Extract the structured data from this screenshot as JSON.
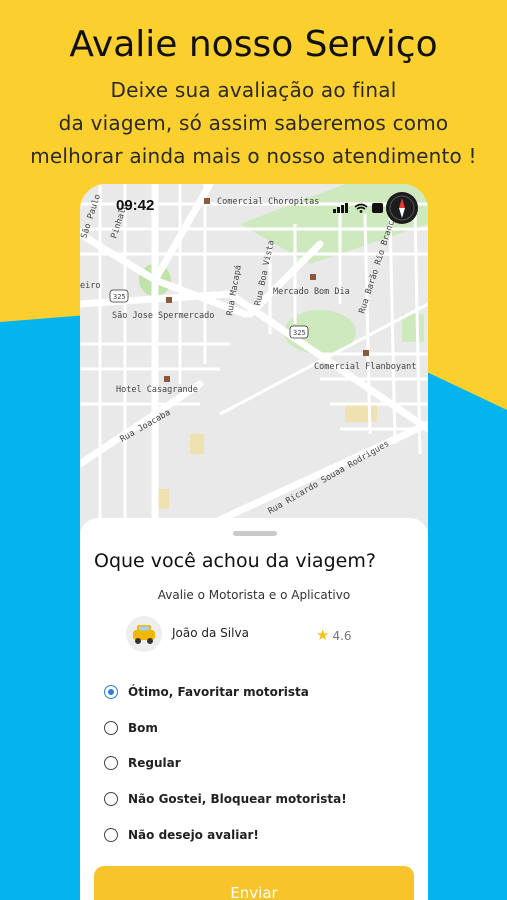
{
  "promo": {
    "headline": "Avalie nosso Serviço",
    "sub_lines": [
      "Deixe sua avaliação ao final",
      "da viagem, só assim saberemos como",
      "melhorar ainda mais o nosso atendimento !"
    ]
  },
  "status_bar": {
    "time": "09:42"
  },
  "map": {
    "labels": {
      "comercial_choropitas": "Comercial Choropitas",
      "sao_jose": "São Jose Spermercado",
      "mercado": "Mercado Bom Dia",
      "hotel": "Hotel Casagrande",
      "flanboyant": "Comercial Flanboyant",
      "rua_macapa": "Rua Macapá",
      "rua_boa_vista": "Rua Boa Vista",
      "rua_joacaba": "Rua Joacaba",
      "rua_ricardo": "Rua Ricardo Souaa Rodrigues",
      "rua_barao": "Rua Barão Rio Branco",
      "rua_sao_paulo": "São Paulo",
      "rua_pinhalo": "Pinhalo",
      "rua_eiro": "eiro",
      "road_325a": "325",
      "road_325b": "325"
    }
  },
  "sheet": {
    "title": "Oque você achou da viagem?",
    "subtitle": "Avalie o Motorista e o Aplicativo",
    "driver": {
      "name": "João da Silva",
      "rating": "4.6"
    },
    "options": [
      {
        "label": "Ótimo, Favoritar motorista",
        "selected": true
      },
      {
        "label": "Bom",
        "selected": false
      },
      {
        "label": "Regular",
        "selected": false
      },
      {
        "label": "Não Gostei, Bloquear motorista!",
        "selected": false
      },
      {
        "label": "Não desejo avaliar!",
        "selected": false
      }
    ],
    "submit_label": "Enviar"
  },
  "colors": {
    "yellow": "#fbd02e",
    "blue": "#00b4f0",
    "accent": "#2a7de1",
    "button": "#f7c52b"
  }
}
